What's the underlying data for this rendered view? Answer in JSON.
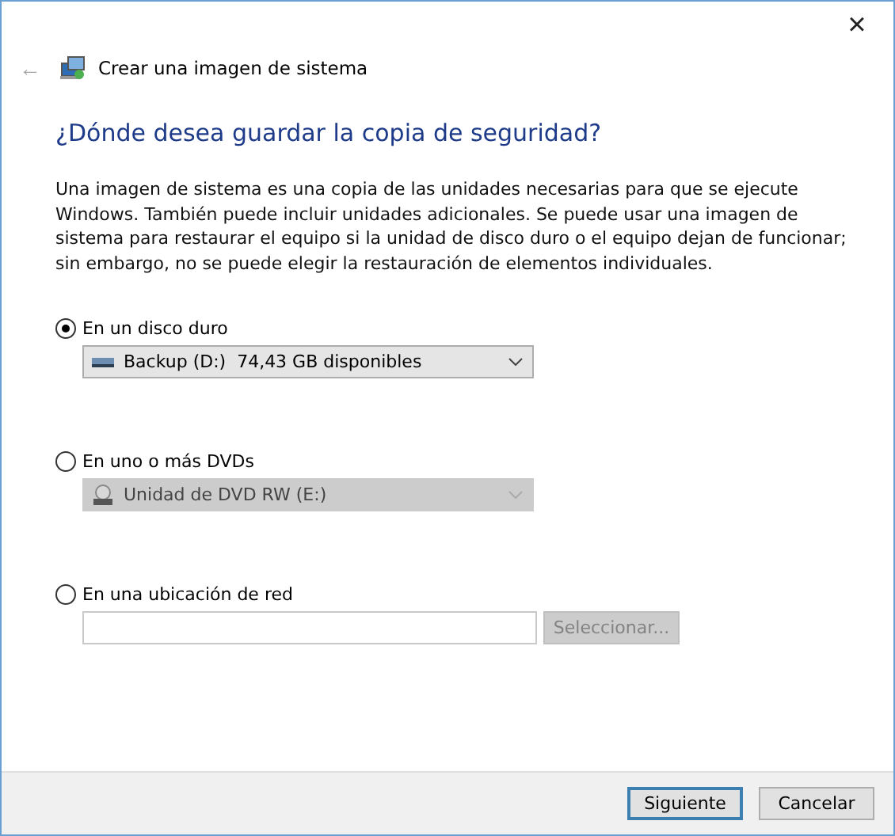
{
  "window": {
    "close": "×"
  },
  "header": {
    "back": "←",
    "title": "Crear una imagen de sistema"
  },
  "heading": "¿Dónde desea guardar la copia de seguridad?",
  "description": "Una imagen de sistema es una copia de las unidades necesarias para que se ejecute Windows. También puede incluir unidades adicionales. Se puede usar una imagen de sistema para restaurar el equipo si la unidad de disco duro o el equipo dejan de funcionar; sin embargo, no se puede elegir la restauración de elementos individuales.",
  "options": [
    {
      "kind": "harddisk",
      "label": "En un disco duro",
      "selected": true,
      "dropdown": {
        "value": "Backup (D:)  74,43 GB disponibles",
        "disabled": false
      }
    },
    {
      "kind": "dvd",
      "label": "En uno o más DVDs",
      "selected": false,
      "dropdown": {
        "value": "Unidad de DVD RW (E:)",
        "disabled": true
      }
    },
    {
      "kind": "network",
      "label": "En una ubicación de red",
      "selected": false,
      "browse": {
        "label": "Seleccionar...",
        "disabled": true
      }
    }
  ],
  "buttons": [
    {
      "label": "Siguiente",
      "default": true
    },
    {
      "label": "Cancelar",
      "default": false
    }
  ]
}
